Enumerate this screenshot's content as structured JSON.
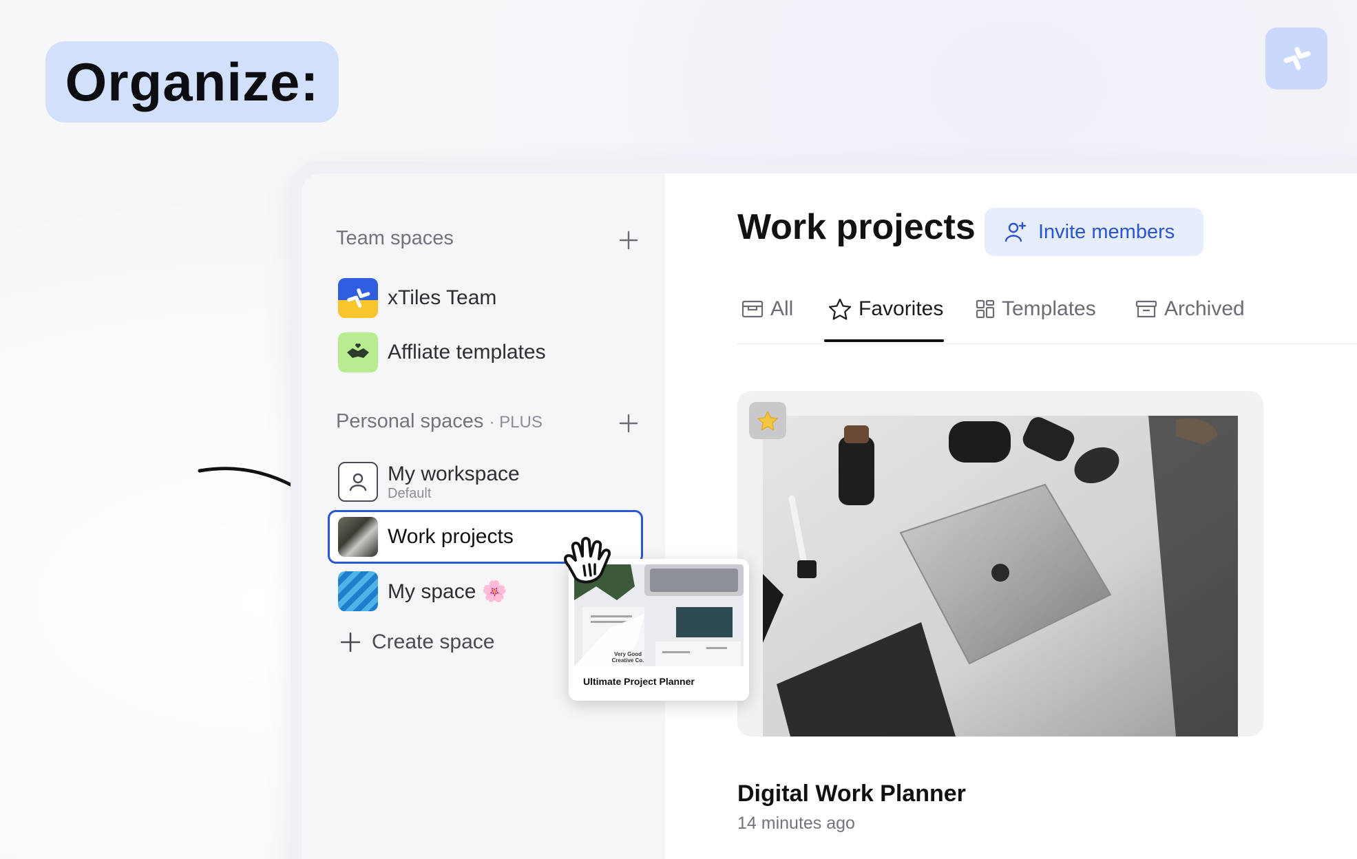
{
  "heading": {
    "label": "Organize:"
  },
  "sidebar": {
    "team_section": {
      "label": "Team spaces"
    },
    "team_spaces": [
      {
        "label": "xTiles Team",
        "icon": "xtiles-logo-icon"
      },
      {
        "label": "Affliate templates",
        "icon": "handshake-icon"
      }
    ],
    "personal_section": {
      "label": "Personal spaces",
      "tier": "· PLUS"
    },
    "personal_spaces": [
      {
        "label": "My workspace",
        "sublabel": "Default",
        "icon": "user-icon"
      },
      {
        "label": "Work projects",
        "icon": "desk-photo-icon",
        "selected": true
      },
      {
        "label": "My space 🌸",
        "icon": "blue-waves-icon"
      }
    ],
    "create_space": {
      "label": "Create space"
    }
  },
  "main": {
    "title": "Work projects",
    "invite_button": {
      "label": "Invite members"
    },
    "tabs": [
      {
        "label": "All",
        "icon": "inbox-icon"
      },
      {
        "label": "Favorites",
        "icon": "star-icon",
        "active": true
      },
      {
        "label": "Templates",
        "icon": "grid-icon"
      },
      {
        "label": "Archived",
        "icon": "archive-icon"
      }
    ],
    "card": {
      "title": "Digital Work Planner",
      "time": "14 minutes ago",
      "favorite": true
    }
  },
  "drag_preview": {
    "label": "Ultimate Project Planner",
    "tiny_text": "Very Good Creative Co."
  },
  "colors": {
    "accent": "#2a55d4",
    "badge_bg": "#d3e0fb",
    "invite_bg": "#e6edfd",
    "star": "#f4c542"
  }
}
